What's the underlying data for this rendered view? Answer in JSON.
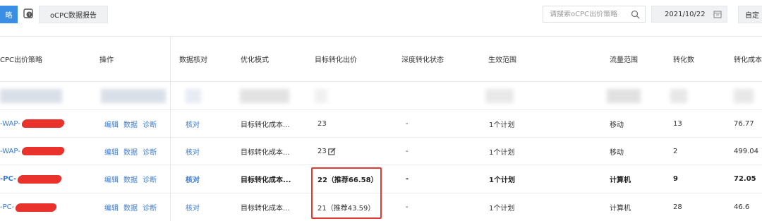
{
  "toolbar": {
    "primary_label": "略",
    "help_icon": "help-icon",
    "report_label": "oCPC数据报告",
    "search_placeholder": "请搜索oCPC出价策略",
    "date_value": "2021/10/22",
    "custom_label": "自定"
  },
  "table": {
    "headers": {
      "strategy": "CPC出价策略",
      "ops": "操作",
      "check": "数据核对",
      "mode": "优化模式",
      "bid": "目标转化出价",
      "deep": "深度转化状态",
      "range": "生效范围",
      "traffic": "流量范围",
      "conv": "转化数",
      "cost": "转化成本"
    },
    "ops_labels": {
      "edit": "编辑",
      "data": "数据",
      "diag": "诊断"
    },
    "rows": [
      {
        "name": "-WAP-",
        "check": "核对",
        "mode": "目标转化成本...",
        "bid": "23",
        "deep": "-",
        "range": "1个计划",
        "traffic": "移动",
        "conv": "13",
        "cost": "76.77"
      },
      {
        "name": "-WAP-",
        "check": "核对",
        "mode": "目标转化成本...",
        "bid": "23",
        "deep": "-",
        "range": "1个计划",
        "traffic": "移动",
        "conv": "2",
        "cost": "499.04"
      },
      {
        "name": "-PC-",
        "check": "核对",
        "mode": "目标转化成本...",
        "bid": "22（推荐66.58）",
        "deep": "-",
        "range": "1个计划",
        "traffic": "计算机",
        "conv": "9",
        "cost": "72.05"
      },
      {
        "name": "-PC-",
        "check": "核对",
        "mode": "目标转化成本...",
        "bid": "21（推荐43.59）",
        "deep": "-",
        "range": "1个计划",
        "traffic": "计算机",
        "conv": "28",
        "cost": "46.6"
      }
    ]
  },
  "colors": {
    "primary": "#3a8ee6",
    "link": "#3a7bd5",
    "highlight": "#e53935",
    "redaction": "#e8322b"
  }
}
